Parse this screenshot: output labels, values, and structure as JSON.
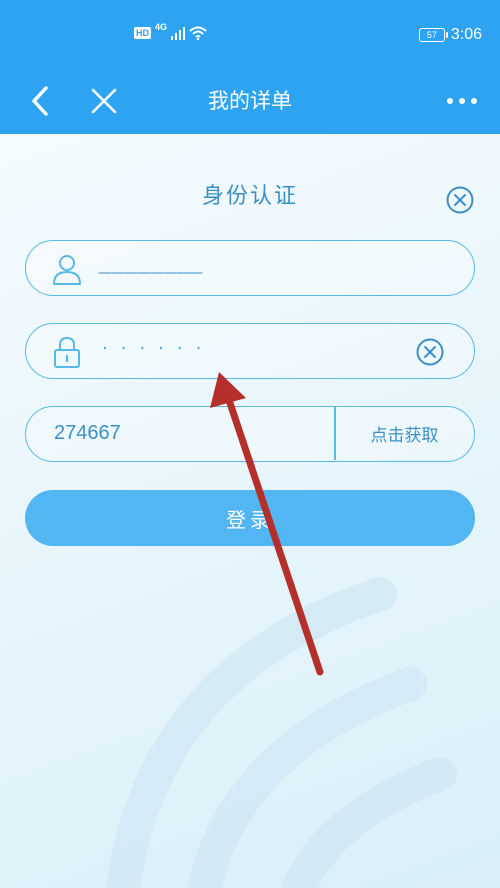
{
  "status": {
    "hd_badge": "HD",
    "network": "4G",
    "battery": "57",
    "time": "3:06"
  },
  "nav": {
    "title": "我的详单",
    "icons": {
      "back": "chevron-left-icon",
      "close": "close-icon",
      "more": "more-dots-icon"
    }
  },
  "dialog": {
    "title": "身份认证",
    "username": {
      "value": "————————",
      "icon": "user-icon"
    },
    "password": {
      "masked_value": "······",
      "icon": "lock-icon",
      "clear_icon": "clear-circle-icon"
    },
    "verification": {
      "value": "274667",
      "get_code_label": "点击获取"
    },
    "login_label": "登录"
  },
  "colors": {
    "header": "#2ea3f2",
    "accent": "#3b8fc9",
    "field_border": "#56b9ea",
    "login_button": "#52b6f3",
    "annotation_arrow": "#b5302a"
  }
}
